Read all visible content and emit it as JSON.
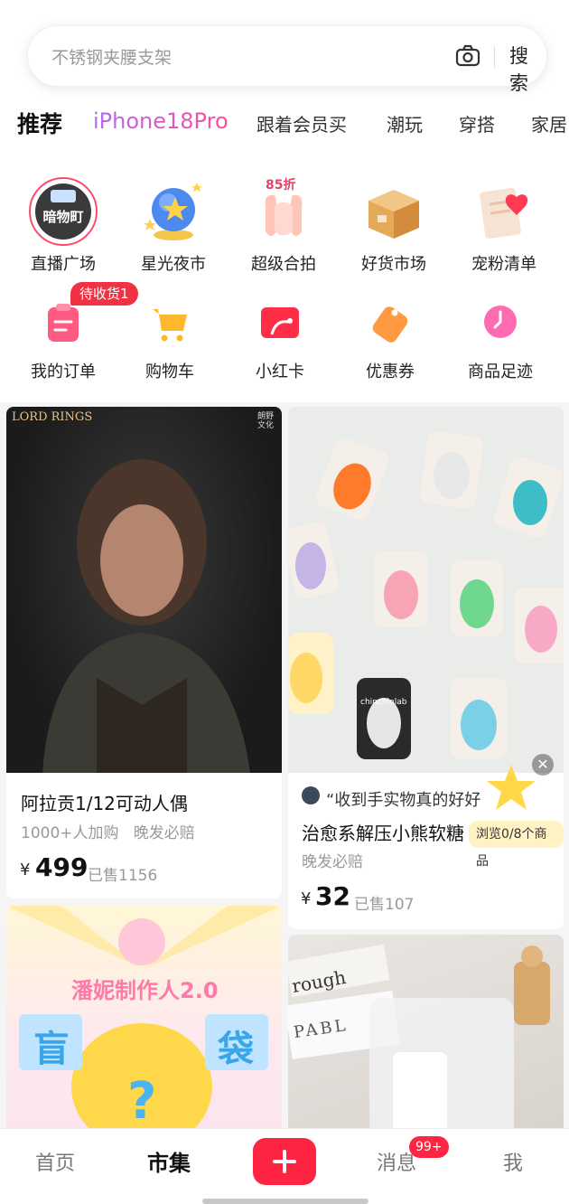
{
  "search": {
    "placeholder": "不锈钢夹腰支架",
    "button": "搜索"
  },
  "tabs": [
    "推荐",
    "iPhone18Pro",
    "跟着会员买",
    "潮玩",
    "穿搭",
    "家居"
  ],
  "grid_row1": [
    {
      "label": "直播广场",
      "icon": "live-shop-logo-icon",
      "logo_text": "暗物町"
    },
    {
      "label": "星光夜市",
      "icon": "star-globe-icon"
    },
    {
      "label": "超级合拍",
      "icon": "clapping-hands-icon",
      "tag": "85折"
    },
    {
      "label": "好货市场",
      "icon": "package-box-icon"
    },
    {
      "label": "宠粉清单",
      "icon": "coupon-heart-icon"
    }
  ],
  "grid_row2": [
    {
      "label": "我的订单",
      "icon": "order-clipboard-icon"
    },
    {
      "label": "购物车",
      "icon": "shopping-cart-icon"
    },
    {
      "label": "小红卡",
      "icon": "red-card-icon"
    },
    {
      "label": "优惠券",
      "icon": "coupon-tag-icon"
    },
    {
      "label": "商品足迹",
      "icon": "clock-icon"
    }
  ],
  "order_badge": "待收货1",
  "products": [
    {
      "title": "阿拉贡1/12可动人偶",
      "sub": "1000+人加购   晚发必赔",
      "currency": "¥",
      "price": "499",
      "sold": "已售1156",
      "image_brand": "LORD RINGS",
      "image_tag": "朗野文化"
    },
    {
      "title": "治愈系解压小熊软糖",
      "review": "“收到手实物真的好好",
      "sub": "晚发必赔",
      "currency": "¥",
      "price": "32",
      "sold": "已售107",
      "browse_tip": "浏览0/8个商品",
      "toy_label": "chinchinlab"
    },
    {
      "image_title": "潘妮制作人2.0",
      "blind_left": "盲",
      "blind_right": "袋",
      "mark": "?"
    },
    {
      "image_text": "rough",
      "image_text2": "PABL"
    }
  ],
  "nav": {
    "home": "首页",
    "market": "市集",
    "messages": "消息",
    "me": "我",
    "msg_badge": "99+"
  },
  "colors": {
    "accent": "#ff2442",
    "badge": "#f03344"
  }
}
